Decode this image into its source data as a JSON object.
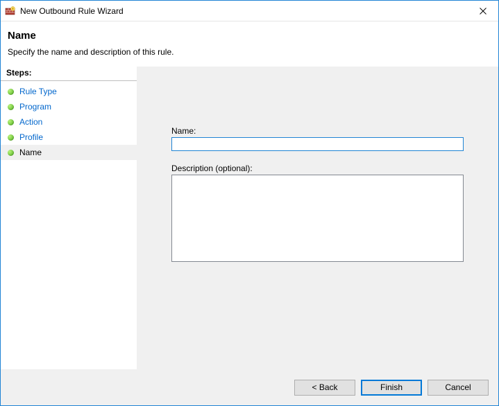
{
  "titlebar": {
    "title": "New Outbound Rule Wizard"
  },
  "header": {
    "heading": "Name",
    "subtitle": "Specify the name and description of this rule."
  },
  "sidebar": {
    "title": "Steps:",
    "items": [
      {
        "label": "Rule Type",
        "current": false
      },
      {
        "label": "Program",
        "current": false
      },
      {
        "label": "Action",
        "current": false
      },
      {
        "label": "Profile",
        "current": false
      },
      {
        "label": "Name",
        "current": true
      }
    ]
  },
  "form": {
    "name_label": "Name:",
    "name_value": "",
    "desc_label": "Description (optional):",
    "desc_value": ""
  },
  "footer": {
    "back": "< Back",
    "finish": "Finish",
    "cancel": "Cancel"
  }
}
